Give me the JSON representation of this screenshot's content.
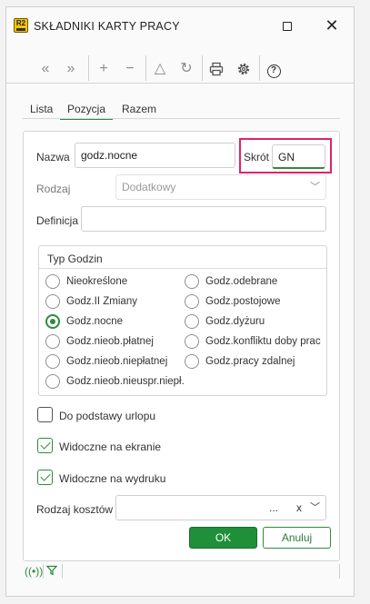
{
  "window": {
    "logo_text": "R2",
    "title": "SKŁADNIKI KARTY PRACY"
  },
  "toolbar": {
    "first": "«",
    "last": "»",
    "add": "+",
    "remove": "−",
    "up": "△",
    "refresh": "↻",
    "help": "?"
  },
  "tabs": [
    {
      "label": "Lista",
      "active": false
    },
    {
      "label": "Pozycja",
      "active": true
    },
    {
      "label": "Razem",
      "active": false
    }
  ],
  "form": {
    "name_label": "Nazwa",
    "name_value": "godz.nocne",
    "short_label": "Skrót",
    "short_value": "GN",
    "type_label": "Rodzaj",
    "type_value": "Dodatkowy",
    "definition_label": "Definicja",
    "definition_value": "",
    "hours_group_title": "Typ Godzin",
    "hour_types_left": [
      {
        "label": "Nieokreślone",
        "selected": false
      },
      {
        "label": "Godz.II Zmiany",
        "selected": false
      },
      {
        "label": "Godz.nocne",
        "selected": true
      },
      {
        "label": "Godz.nieob.płatnej",
        "selected": false
      },
      {
        "label": "Godz.nieob.niepłatnej",
        "selected": false
      },
      {
        "label": "Godz.nieob.nieuspr.niepł.",
        "selected": false
      }
    ],
    "hour_types_right": [
      {
        "label": "Godz.odebrane",
        "selected": false
      },
      {
        "label": "Godz.postojowe",
        "selected": false
      },
      {
        "label": "Godz.dyżuru",
        "selected": false
      },
      {
        "label": "Godz.konfliktu doby prac",
        "selected": false
      },
      {
        "label": "Godz.pracy zdalnej",
        "selected": false
      }
    ],
    "leave_base_label": "Do podstawy urlopu",
    "leave_base_checked": false,
    "visible_screen_label": "Widoczne na ekranie",
    "visible_screen_checked": true,
    "visible_print_label": "Widoczne na wydruku",
    "visible_print_checked": true,
    "cost_type_label": "Rodzaj kosztów",
    "cost_type_value": "",
    "cost_more": "...",
    "cost_clear": "x",
    "ok_label": "OK",
    "cancel_label": "Anuluj"
  },
  "colors": {
    "accent": "#2e8b3e",
    "highlight": "#e0226b"
  }
}
